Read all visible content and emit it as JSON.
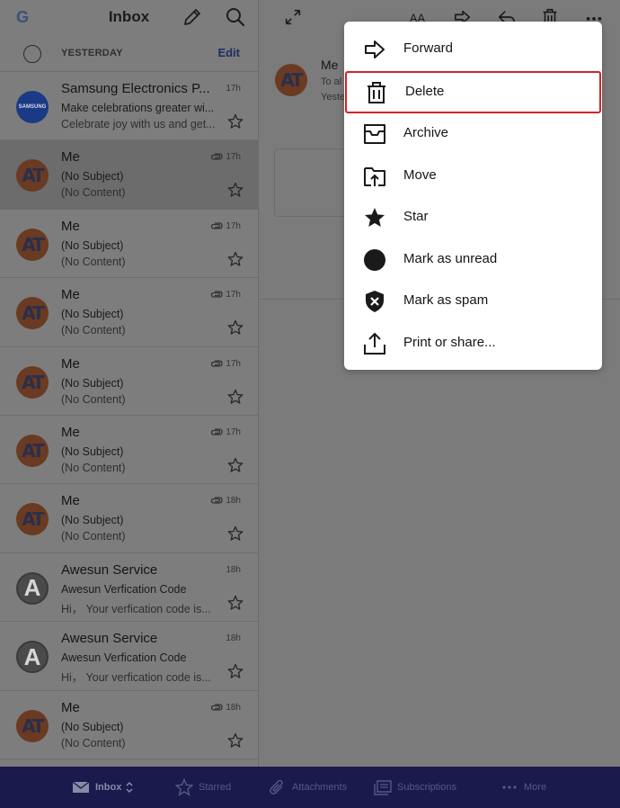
{
  "header": {
    "logo": "G",
    "title": "Inbox",
    "section_label": "YESTERDAY",
    "edit_label": "Edit"
  },
  "messages": [
    {
      "sender": "Samsung Electronics P...",
      "subject": "Make celebrations greater wi...",
      "preview": "Celebrate joy with us and get...",
      "time": "17h",
      "avatar": "samsung",
      "avatar_text": "SAMSUNG",
      "attachment": false
    },
    {
      "sender": "Me",
      "subject": "(No Subject)",
      "preview": "(No Content)",
      "time": "17h",
      "avatar": "at",
      "avatar_text": "AT",
      "attachment": true
    },
    {
      "sender": "Me",
      "subject": "(No Subject)",
      "preview": "(No Content)",
      "time": "17h",
      "avatar": "at",
      "avatar_text": "AT",
      "attachment": true
    },
    {
      "sender": "Me",
      "subject": "(No Subject)",
      "preview": "(No Content)",
      "time": "17h",
      "avatar": "at",
      "avatar_text": "AT",
      "attachment": true
    },
    {
      "sender": "Me",
      "subject": "(No Subject)",
      "preview": "(No Content)",
      "time": "17h",
      "avatar": "at",
      "avatar_text": "AT",
      "attachment": true
    },
    {
      "sender": "Me",
      "subject": "(No Subject)",
      "preview": "(No Content)",
      "time": "17h",
      "avatar": "at",
      "avatar_text": "AT",
      "attachment": true
    },
    {
      "sender": "Me",
      "subject": "(No Subject)",
      "preview": "(No Content)",
      "time": "18h",
      "avatar": "at",
      "avatar_text": "AT",
      "attachment": true
    },
    {
      "sender": "Awesun Service",
      "subject": "Awesun Verfication Code",
      "preview": "Hi，  Your verfication code is...",
      "time": "18h",
      "avatar": "a",
      "avatar_text": "A",
      "attachment": false
    },
    {
      "sender": "Awesun Service",
      "subject": "Awesun Verfication Code",
      "preview": "Hi，  Your verfication code is...",
      "time": "18h",
      "avatar": "a",
      "avatar_text": "A",
      "attachment": false
    },
    {
      "sender": "Me",
      "subject": "(No Subject)",
      "preview": "(No Content)",
      "time": "18h",
      "avatar": "at",
      "avatar_text": "AT",
      "attachment": true
    }
  ],
  "selected_index": 1,
  "reader": {
    "sender": "Me",
    "to": "To al",
    "time": "Yeste"
  },
  "menu": {
    "items": [
      {
        "label": "Forward",
        "icon": "forward-icon"
      },
      {
        "label": "Delete",
        "icon": "trash-icon"
      },
      {
        "label": "Archive",
        "icon": "archive-icon"
      },
      {
        "label": "Move",
        "icon": "move-icon"
      },
      {
        "label": "Star",
        "icon": "star-icon"
      },
      {
        "label": "Mark as unread",
        "icon": "unread-dot-icon"
      },
      {
        "label": "Mark as spam",
        "icon": "spam-shield-icon"
      },
      {
        "label": "Print or share...",
        "icon": "share-icon"
      }
    ],
    "highlighted": "Delete",
    "highlight_color": "#d4232b"
  },
  "bottom_nav": {
    "items": [
      {
        "label": "Inbox",
        "icon": "mail-icon"
      },
      {
        "label": "Starred",
        "icon": "star-outline-icon"
      },
      {
        "label": "Attachments",
        "icon": "paperclip-icon"
      },
      {
        "label": "Subscriptions",
        "icon": "subscriptions-icon"
      },
      {
        "label": "More",
        "icon": "more-dots-icon"
      }
    ],
    "background": "#1b1a4d"
  }
}
